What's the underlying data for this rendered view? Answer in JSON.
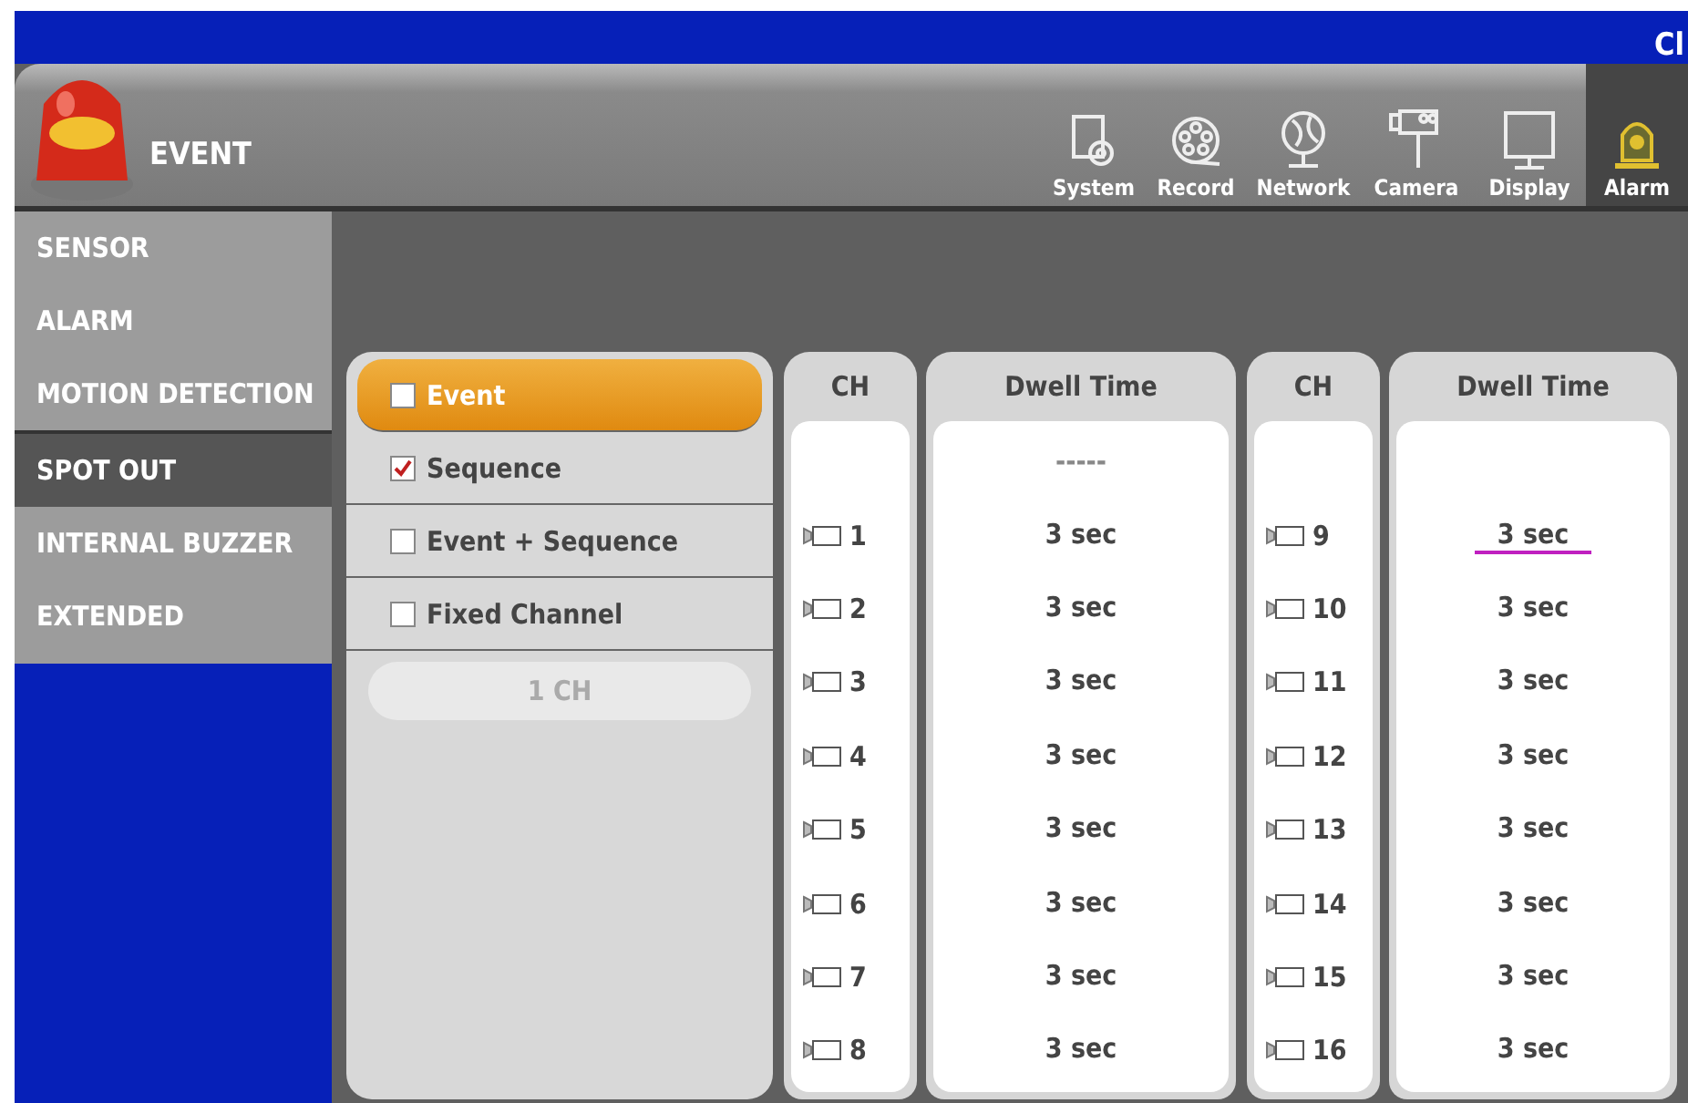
{
  "top_bar": {
    "title": "Cl"
  },
  "header": {
    "title": "EVENT"
  },
  "toolbar": [
    {
      "kind": "system",
      "label": "System",
      "selected": false
    },
    {
      "kind": "record",
      "label": "Record",
      "selected": false
    },
    {
      "kind": "network",
      "label": "Network",
      "selected": false
    },
    {
      "kind": "camera",
      "label": "Camera",
      "selected": false
    },
    {
      "kind": "display",
      "label": "Display",
      "selected": false
    },
    {
      "kind": "alarm",
      "label": "Alarm",
      "selected": true
    }
  ],
  "sidebar": {
    "items": [
      {
        "label": "SENSOR",
        "selected": false
      },
      {
        "label": "ALARM",
        "selected": false
      },
      {
        "label": "MOTION DETECTION",
        "selected": false
      },
      {
        "label": "SPOT OUT",
        "selected": true
      },
      {
        "label": "INTERNAL BUZZER",
        "selected": false
      },
      {
        "label": "EXTENDED",
        "selected": false
      }
    ]
  },
  "modes": [
    {
      "label": "Event",
      "checked": false,
      "selected": true
    },
    {
      "label": "Sequence",
      "checked": true,
      "selected": false
    },
    {
      "label": "Event + Sequence",
      "checked": false,
      "selected": false
    },
    {
      "label": "Fixed Channel",
      "checked": false,
      "selected": false
    }
  ],
  "fixed_channel_button": {
    "label": "1 CH",
    "disabled": true
  },
  "channel_tables": [
    {
      "columns": [
        "CH",
        "Dwell Time"
      ],
      "top_row": "-----",
      "rows": [
        {
          "ch": "1",
          "dwell": "3 sec",
          "focused": false
        },
        {
          "ch": "2",
          "dwell": "3 sec",
          "focused": false
        },
        {
          "ch": "3",
          "dwell": "3 sec",
          "focused": false
        },
        {
          "ch": "4",
          "dwell": "3 sec",
          "focused": false
        },
        {
          "ch": "5",
          "dwell": "3 sec",
          "focused": false
        },
        {
          "ch": "6",
          "dwell": "3 sec",
          "focused": false
        },
        {
          "ch": "7",
          "dwell": "3 sec",
          "focused": false
        },
        {
          "ch": "8",
          "dwell": "3 sec",
          "focused": false
        }
      ]
    },
    {
      "columns": [
        "CH",
        "Dwell Time"
      ],
      "rows": [
        {
          "ch": "9",
          "dwell": "3 sec",
          "focused": true
        },
        {
          "ch": "10",
          "dwell": "3 sec",
          "focused": false
        },
        {
          "ch": "11",
          "dwell": "3 sec",
          "focused": false
        },
        {
          "ch": "12",
          "dwell": "3 sec",
          "focused": false
        },
        {
          "ch": "13",
          "dwell": "3 sec",
          "focused": false
        },
        {
          "ch": "14",
          "dwell": "3 sec",
          "focused": false
        },
        {
          "ch": "15",
          "dwell": "3 sec",
          "focused": false
        },
        {
          "ch": "16",
          "dwell": "3 sec",
          "focused": false
        }
      ]
    }
  ]
}
